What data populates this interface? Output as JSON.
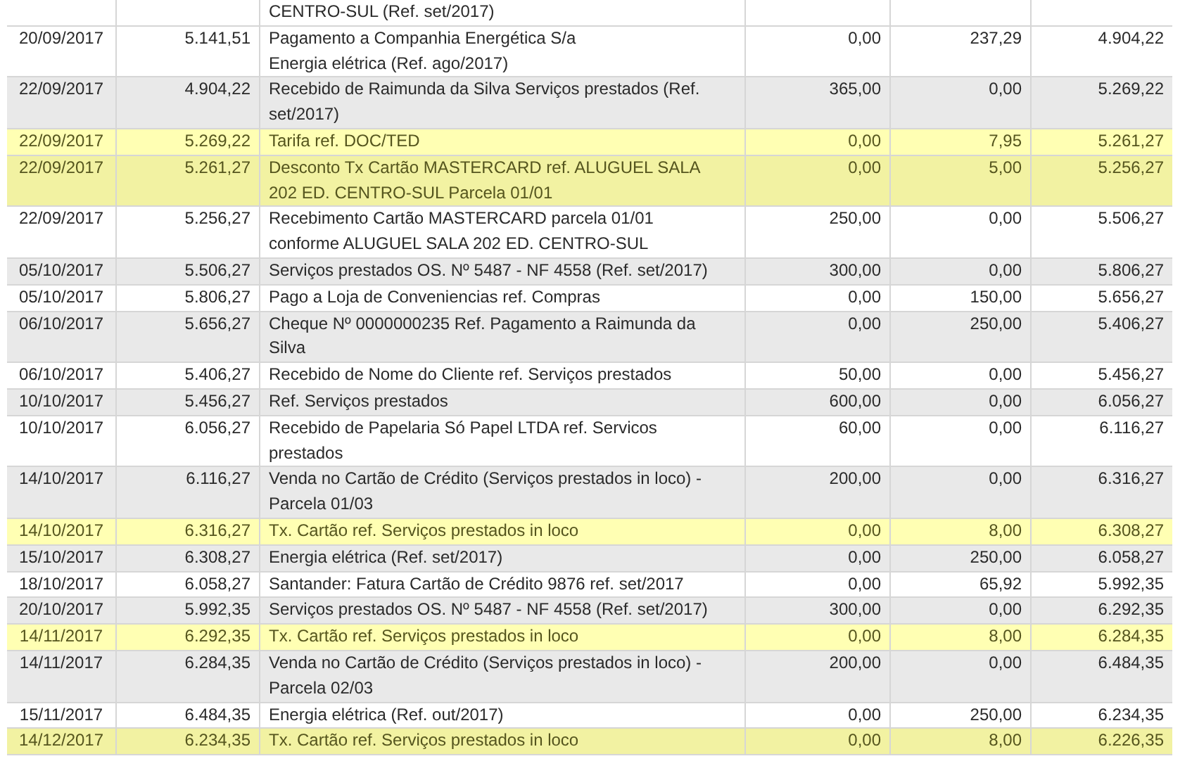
{
  "rows": [
    {
      "cells": [
        "",
        "",
        [
          "CENTRO-SUL (Ref. set/2017)"
        ],
        "",
        "",
        ""
      ],
      "shaded": false,
      "highlighted": false
    },
    {
      "cells": [
        "20/09/2017",
        "5.141,51",
        [
          "Pagamento a Companhia Energética S/a",
          "Energia elétrica (Ref. ago/2017)"
        ],
        "0,00",
        "237,29",
        "4.904,22"
      ],
      "shaded": false,
      "highlighted": false
    },
    {
      "cells": [
        "22/09/2017",
        "4.904,22",
        [
          "Recebido de Raimunda da Silva Serviços prestados (Ref.",
          "set/2017)"
        ],
        "365,00",
        "0,00",
        "5.269,22"
      ],
      "shaded": true,
      "highlighted": false
    },
    {
      "cells": [
        "22/09/2017",
        "5.269,22",
        [
          "Tarifa ref. DOC/TED"
        ],
        "0,00",
        "7,95",
        "5.261,27"
      ],
      "shaded": false,
      "highlighted": true
    },
    {
      "cells": [
        "22/09/2017",
        "5.261,27",
        [
          "Desconto Tx Cartão MASTERCARD ref. ALUGUEL SALA",
          "202 ED. CENTRO-SUL Parcela 01/01"
        ],
        "0,00",
        "5,00",
        "5.256,27"
      ],
      "shaded": true,
      "highlighted": true
    },
    {
      "cells": [
        "22/09/2017",
        "5.256,27",
        [
          "Recebimento Cartão MASTERCARD parcela 01/01",
          "conforme ALUGUEL SALA 202 ED. CENTRO-SUL"
        ],
        "250,00",
        "0,00",
        "5.506,27"
      ],
      "shaded": false,
      "highlighted": false
    },
    {
      "cells": [
        "05/10/2017",
        "5.506,27",
        [
          "Serviços prestados OS. Nº 5487 - NF 4558 (Ref. set/2017)"
        ],
        "300,00",
        "0,00",
        "5.806,27"
      ],
      "shaded": true,
      "highlighted": false
    },
    {
      "cells": [
        "05/10/2017",
        "5.806,27",
        [
          "Pago a Loja de Conveniencias ref. Compras"
        ],
        "0,00",
        "150,00",
        "5.656,27"
      ],
      "shaded": false,
      "highlighted": false
    },
    {
      "cells": [
        "06/10/2017",
        "5.656,27",
        [
          "Cheque Nº 0000000235 Ref. Pagamento a Raimunda da",
          "Silva"
        ],
        "0,00",
        "250,00",
        "5.406,27"
      ],
      "shaded": true,
      "highlighted": false
    },
    {
      "cells": [
        "06/10/2017",
        "5.406,27",
        [
          "Recebido de Nome do Cliente ref. Serviços prestados"
        ],
        "50,00",
        "0,00",
        "5.456,27"
      ],
      "shaded": false,
      "highlighted": false
    },
    {
      "cells": [
        "10/10/2017",
        "5.456,27",
        [
          "Ref. Serviços prestados"
        ],
        "600,00",
        "0,00",
        "6.056,27"
      ],
      "shaded": true,
      "highlighted": false
    },
    {
      "cells": [
        "10/10/2017",
        "6.056,27",
        [
          "Recebido de Papelaria Só Papel LTDA ref. Servicos",
          "prestados"
        ],
        "60,00",
        "0,00",
        "6.116,27"
      ],
      "shaded": false,
      "highlighted": false
    },
    {
      "cells": [
        "14/10/2017",
        "6.116,27",
        [
          "Venda no Cartão de Crédito (Serviços prestados in loco) -",
          "Parcela 01/03"
        ],
        "200,00",
        "0,00",
        "6.316,27"
      ],
      "shaded": true,
      "highlighted": false
    },
    {
      "cells": [
        "14/10/2017",
        "6.316,27",
        [
          "Tx. Cartão ref. Serviços prestados in loco"
        ],
        "0,00",
        "8,00",
        "6.308,27"
      ],
      "shaded": false,
      "highlighted": true
    },
    {
      "cells": [
        "15/10/2017",
        "6.308,27",
        [
          "Energia elétrica (Ref. set/2017)"
        ],
        "0,00",
        "250,00",
        "6.058,27"
      ],
      "shaded": true,
      "highlighted": false
    },
    {
      "cells": [
        "18/10/2017",
        "6.058,27",
        [
          "Santander: Fatura Cartão de Crédito 9876 ref. set/2017"
        ],
        "0,00",
        "65,92",
        "5.992,35"
      ],
      "shaded": false,
      "highlighted": false
    },
    {
      "cells": [
        "20/10/2017",
        "5.992,35",
        [
          "Serviços prestados OS. Nº 5487 - NF 4558 (Ref. set/2017)"
        ],
        "300,00",
        "0,00",
        "6.292,35"
      ],
      "shaded": true,
      "highlighted": false
    },
    {
      "cells": [
        "14/11/2017",
        "6.292,35",
        [
          "Tx. Cartão ref. Serviços prestados in loco"
        ],
        "0,00",
        "8,00",
        "6.284,35"
      ],
      "shaded": false,
      "highlighted": true
    },
    {
      "cells": [
        "14/11/2017",
        "6.284,35",
        [
          "Venda no Cartão de Crédito (Serviços prestados in loco) -",
          "Parcela 02/03"
        ],
        "200,00",
        "0,00",
        "6.484,35"
      ],
      "shaded": true,
      "highlighted": false
    },
    {
      "cells": [
        "15/11/2017",
        "6.484,35",
        [
          "Energia elétrica (Ref. out/2017)"
        ],
        "0,00",
        "250,00",
        "6.234,35"
      ],
      "shaded": false,
      "highlighted": false
    },
    {
      "cells": [
        "14/12/2017",
        "6.234,35",
        [
          "Tx. Cartão ref. Serviços prestados in loco"
        ],
        "0,00",
        "8,00",
        "6.226,35"
      ],
      "shaded": true,
      "highlighted": true
    }
  ]
}
